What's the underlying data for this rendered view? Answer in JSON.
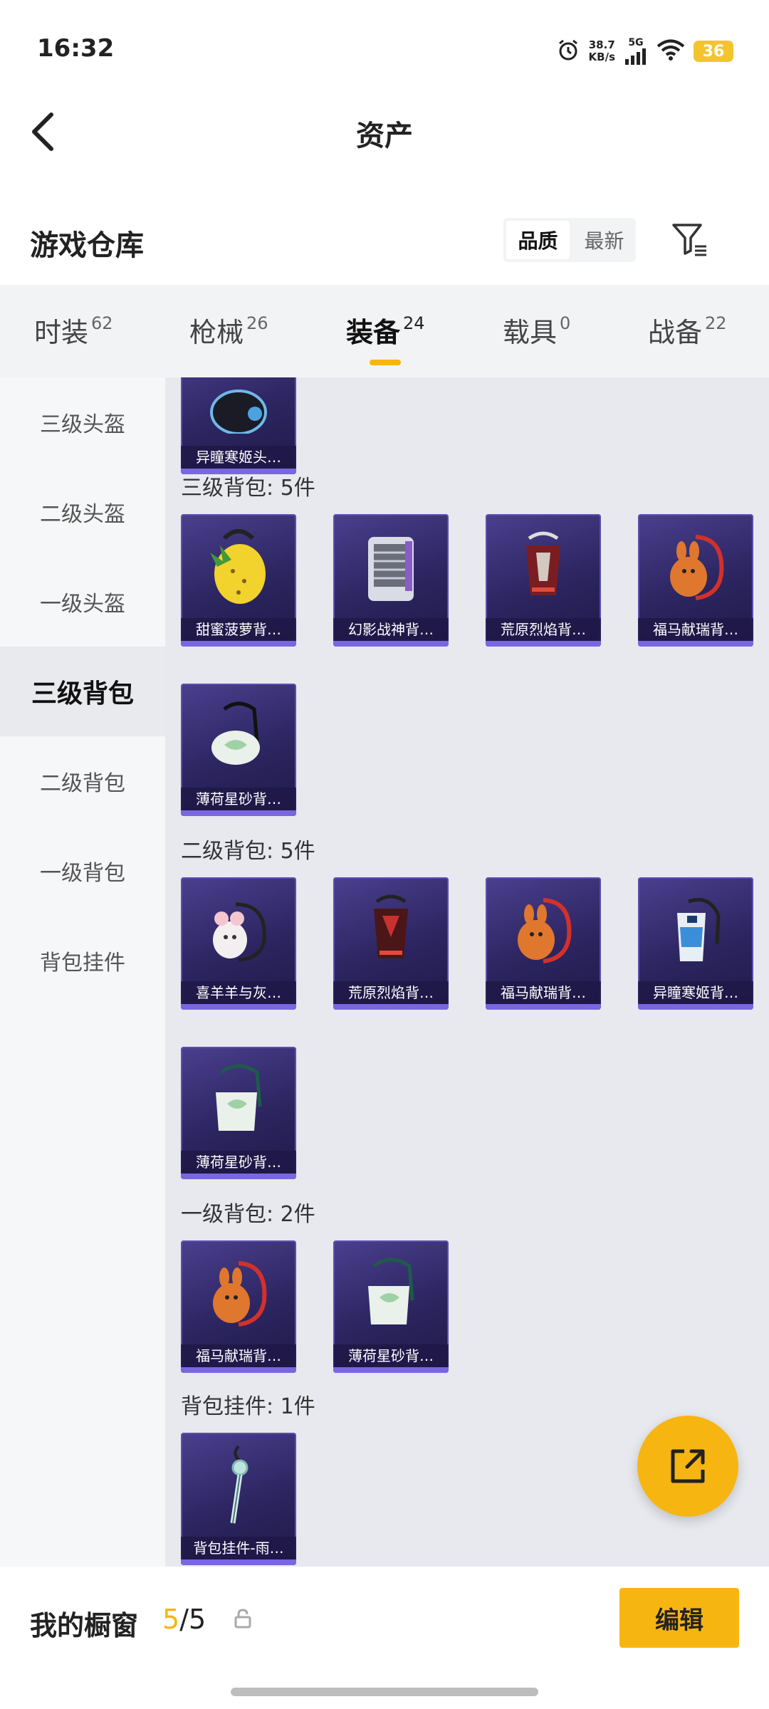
{
  "status_bar": {
    "time": "16:32",
    "net_speed_value": "38.7",
    "net_speed_unit": "KB/s",
    "network": "5G",
    "battery": "36",
    "icons": [
      "alarm-icon",
      "signal-icon",
      "wifi-icon",
      "battery-icon"
    ]
  },
  "header": {
    "title": "资产",
    "back_icon": "chevron-left-icon"
  },
  "warehouse": {
    "title": "游戏仓库",
    "sort_options": [
      "品质",
      "最新"
    ],
    "sort_selected": "品质",
    "filter_icon": "filter-icon"
  },
  "tabs": [
    {
      "label": "时装",
      "count": "62"
    },
    {
      "label": "枪械",
      "count": "26"
    },
    {
      "label": "装备",
      "count": "24",
      "active": true
    },
    {
      "label": "载具",
      "count": "0"
    },
    {
      "label": "战备",
      "count": "22"
    }
  ],
  "sidebar": {
    "items": [
      {
        "label": "三级头盔"
      },
      {
        "label": "二级头盔"
      },
      {
        "label": "一级头盔"
      },
      {
        "label": "三级背包",
        "active": true
      },
      {
        "label": "二级背包"
      },
      {
        "label": "一级背包"
      },
      {
        "label": "背包挂件"
      }
    ]
  },
  "content": {
    "top_partial_item": {
      "name": "异瞳寒姬头…"
    },
    "sections": [
      {
        "label": "三级背包: 5件",
        "items": [
          {
            "name": "甜蜜菠萝背…"
          },
          {
            "name": "幻影战神背…"
          },
          {
            "name": "荒原烈焰背…"
          },
          {
            "name": "福马献瑞背…"
          },
          {
            "name": "薄荷星砂背…"
          }
        ]
      },
      {
        "label": "二级背包: 5件",
        "items": [
          {
            "name": "喜羊羊与灰…"
          },
          {
            "name": "荒原烈焰背…"
          },
          {
            "name": "福马献瑞背…"
          },
          {
            "name": "异瞳寒姬背…"
          },
          {
            "name": "薄荷星砂背…"
          }
        ]
      },
      {
        "label": "一级背包: 2件",
        "items": [
          {
            "name": "福马献瑞背…"
          },
          {
            "name": "薄荷星砂背…"
          }
        ]
      },
      {
        "label": "背包挂件: 1件",
        "items": [
          {
            "name": "背包挂件-雨…"
          }
        ]
      }
    ]
  },
  "fab": {
    "icon": "share-external-icon"
  },
  "bottom_bar": {
    "label": "我的橱窗",
    "count_current": "5",
    "count_total": "/5",
    "lock_icon": "lock-icon",
    "edit_label": "编辑"
  },
  "colors": {
    "accent": "#f7b512",
    "card_bg": "#2c2560",
    "content_bg": "#e7e9ef"
  }
}
